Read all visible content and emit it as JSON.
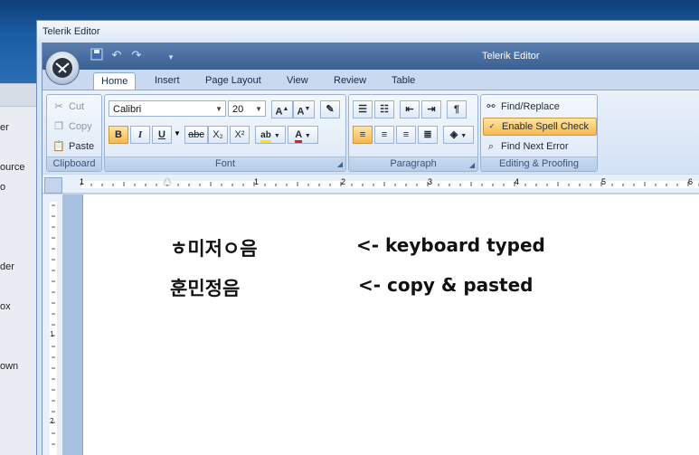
{
  "background_panel": {
    "items": [
      "er",
      "ource",
      "o",
      "der",
      "ox",
      "own"
    ]
  },
  "outer_window": {
    "title": "Telerik Editor"
  },
  "editor_window": {
    "title": "Telerik Editor"
  },
  "tabs": [
    "Home",
    "Insert",
    "Page Layout",
    "View",
    "Review",
    "Table"
  ],
  "clipboard": {
    "cut": "Cut",
    "copy": "Copy",
    "paste": "Paste",
    "label": "Clipboard"
  },
  "font": {
    "family": "Calibri",
    "size": "20",
    "label": "Font",
    "bold": "B",
    "italic": "I",
    "underline": "U",
    "strike": "abc",
    "sub": "X₂",
    "sup": "X²"
  },
  "paragraph": {
    "label": "Paragraph",
    "pilcrow": "¶"
  },
  "editing": {
    "find_replace": "Find/Replace",
    "spell_check": "Enable Spell Check",
    "find_next_error": "Find Next Error",
    "label": "Editing & Proofing"
  },
  "ruler": {
    "h_numbers": [
      "1",
      "1",
      "2",
      "3",
      "4",
      "5",
      "6"
    ],
    "v_numbers": [
      "1",
      "2"
    ]
  },
  "document": {
    "lines": [
      {
        "text": "ㅎ미저ㅇ음",
        "note": "<- keyboard typed"
      },
      {
        "text": "훈민정음",
        "note": "<- copy & pasted"
      }
    ]
  },
  "colors": {
    "accent": "#f8b84c",
    "ribbon": "#d3e2f5",
    "titlebar": "#3b5f92"
  }
}
